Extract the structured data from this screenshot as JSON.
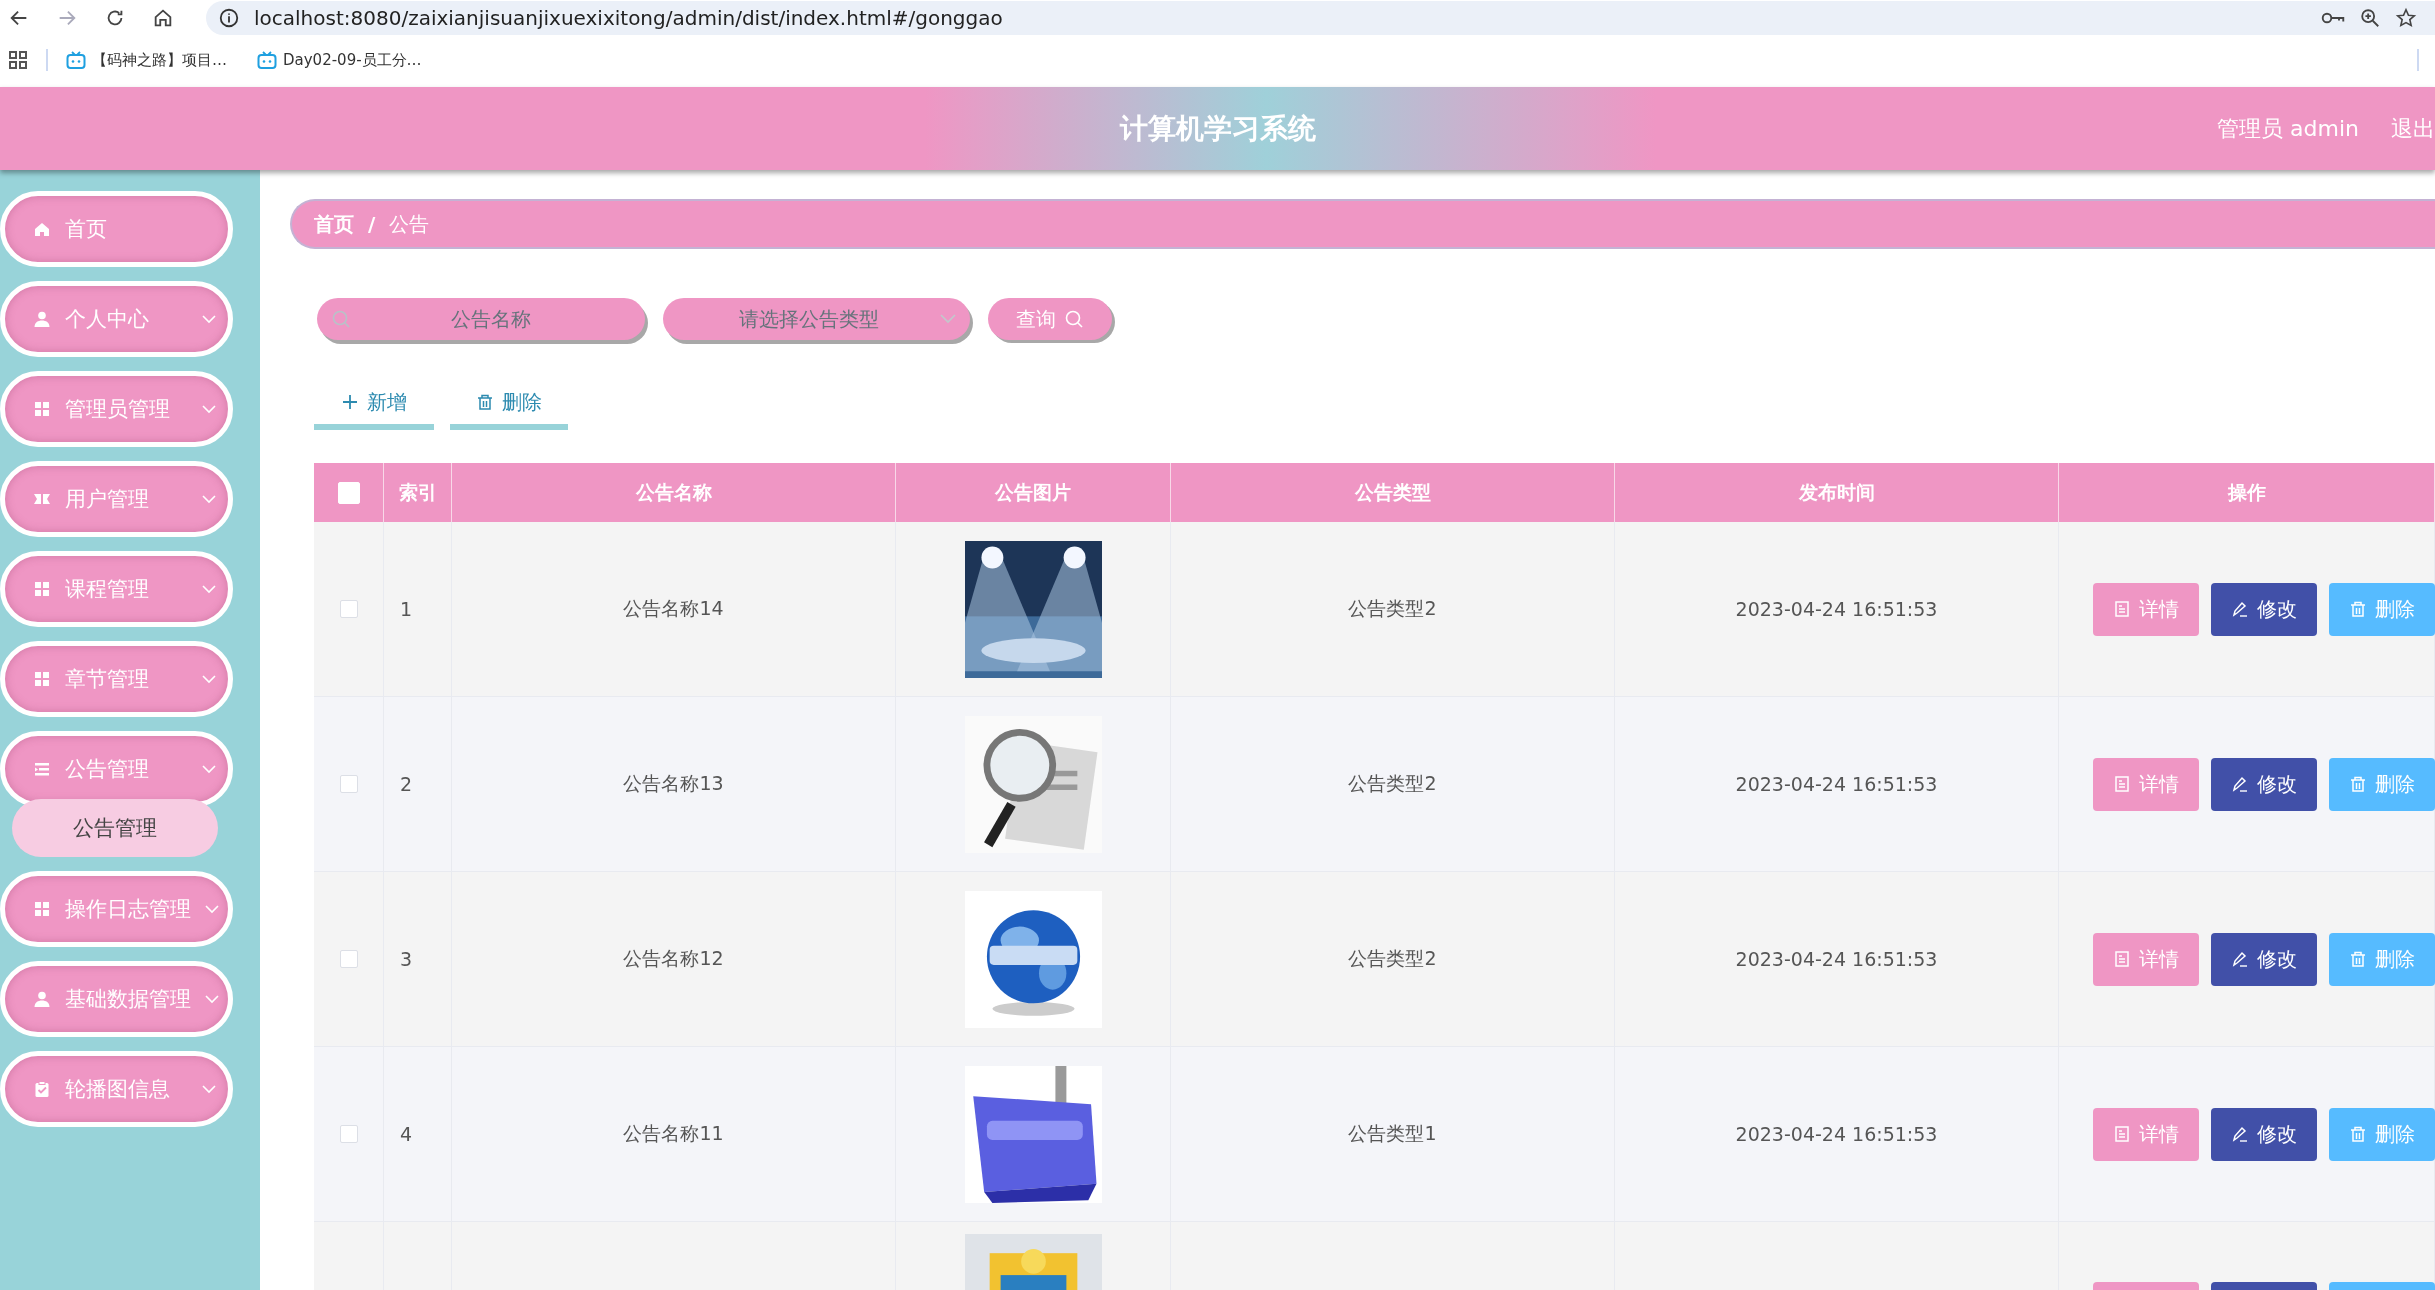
{
  "browser": {
    "url": "localhost:8080/zaixianjisuanjixuexixitong/admin/dist/index.html#/gonggao",
    "forward": {
      "disabled": true
    },
    "bookmarks": [
      {
        "label": "【码神之路】项目…"
      },
      {
        "label": "Day02-09-员工分…"
      }
    ]
  },
  "header": {
    "title": "计算机学习系统",
    "user": "管理员 admin",
    "logout": "退出"
  },
  "sidebar": {
    "items": [
      {
        "label": "首页",
        "kind": "link"
      },
      {
        "label": "个人中心",
        "kind": "menu"
      },
      {
        "label": "管理员管理",
        "kind": "menu"
      },
      {
        "label": "用户管理",
        "kind": "menu"
      },
      {
        "label": "课程管理",
        "kind": "menu"
      },
      {
        "label": "章节管理",
        "kind": "menu"
      },
      {
        "label": "公告管理",
        "kind": "menu",
        "children": [
          {
            "label": "公告管理",
            "selected": true
          }
        ]
      },
      {
        "label": "操作日志管理",
        "kind": "menu"
      },
      {
        "label": "基础数据管理",
        "kind": "menu"
      },
      {
        "label": "轮播图信息",
        "kind": "menu"
      }
    ]
  },
  "breadcrumb": {
    "items": [
      {
        "label": "首页"
      },
      {
        "label": "公告"
      }
    ],
    "separator": "/"
  },
  "search": {
    "name_placeholder": "公告名称",
    "type_placeholder": "请选择公告类型",
    "button": "查询"
  },
  "actions": [
    {
      "kind": "add",
      "label": "新增"
    },
    {
      "kind": "delete",
      "label": "删除"
    }
  ],
  "table": {
    "header_checked": false,
    "columns": [
      "索引",
      "公告名称",
      "公告图片",
      "公告类型",
      "发布时间",
      "操作"
    ],
    "rows": [
      {
        "checked": false,
        "index": "1",
        "name": "公告名称14",
        "image": {
          "kind": "picture"
        },
        "type": "公告类型2",
        "time": "2023-04-24 16:51:53",
        "buttons": [
          {
            "kind": "detail",
            "label": "详情"
          },
          {
            "kind": "edit",
            "label": "修改"
          },
          {
            "kind": "delete",
            "label": "删除"
          }
        ]
      },
      {
        "checked": false,
        "index": "2",
        "name": "公告名称13",
        "image": {
          "kind": "picture"
        },
        "type": "公告类型2",
        "time": "2023-04-24 16:51:53",
        "buttons": [
          {
            "kind": "detail",
            "label": "详情"
          },
          {
            "kind": "edit",
            "label": "修改"
          },
          {
            "kind": "delete",
            "label": "删除"
          }
        ]
      },
      {
        "checked": false,
        "index": "3",
        "name": "公告名称12",
        "image": {
          "kind": "picture"
        },
        "type": "公告类型2",
        "time": "2023-04-24 16:51:53",
        "buttons": [
          {
            "kind": "detail",
            "label": "详情"
          },
          {
            "kind": "edit",
            "label": "修改"
          },
          {
            "kind": "delete",
            "label": "删除"
          }
        ]
      },
      {
        "checked": false,
        "index": "4",
        "name": "公告名称11",
        "image": {
          "kind": "picture"
        },
        "type": "公告类型1",
        "time": "2023-04-24 16:51:53",
        "buttons": [
          {
            "kind": "detail",
            "label": "详情"
          },
          {
            "kind": "edit",
            "label": "修改"
          },
          {
            "kind": "delete",
            "label": "删除"
          }
        ]
      }
    ],
    "cut_row": {
      "image": {
        "kind": "picture"
      },
      "buttons": [
        {
          "kind": "detail"
        },
        {
          "kind": "edit"
        },
        {
          "kind": "delete"
        }
      ]
    }
  }
}
